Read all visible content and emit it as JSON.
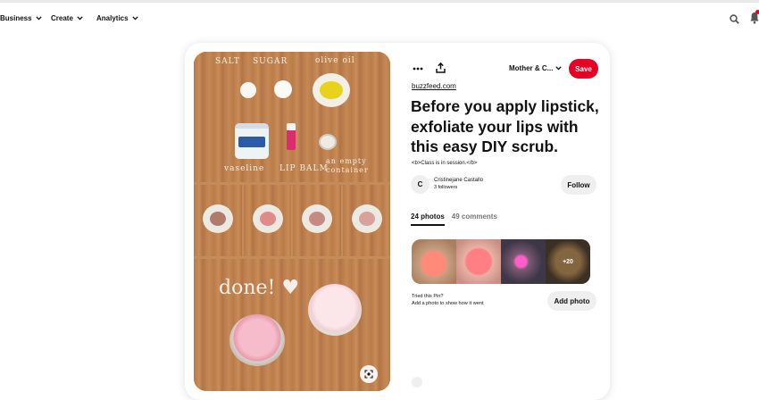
{
  "topnav": {
    "items": [
      {
        "label": "Business"
      },
      {
        "label": "Create"
      },
      {
        "label": "Analytics"
      }
    ]
  },
  "actions": {
    "board_label": "Mother & C...",
    "save_label": "Save"
  },
  "pin": {
    "source": "buzzfeed.com",
    "title": "Before you apply lipstick, exfoliate your lips with this easy DIY scrub.",
    "description": "<b>Class is in session.</b>",
    "image_chalk": {
      "salt": "SALT",
      "sugar": "SUGAR",
      "olive_oil": "olive oil",
      "vaseline": "vaseline",
      "lip_balm": "LIP BALM",
      "empty_container": "an empty container",
      "done": "done! ♥"
    }
  },
  "creator": {
    "initial": "C",
    "name": "Cristinejane Castallo",
    "followers": "3 followers",
    "follow_label": "Follow"
  },
  "tabs": [
    {
      "label": "24 photos",
      "active": true
    },
    {
      "label": "49 comments",
      "active": false
    }
  ],
  "photos": {
    "more_count": "+20"
  },
  "tried": {
    "line1": "Tried this Pin?",
    "line2": "Add a photo to show how it went",
    "add_photo_label": "Add photo"
  },
  "colors": {
    "brand_red": "#e60023",
    "button_gray": "#efefef"
  }
}
